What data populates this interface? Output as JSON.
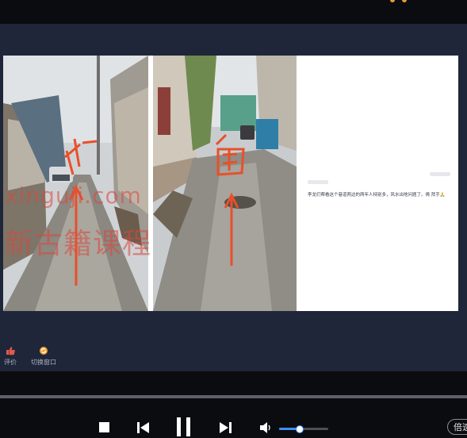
{
  "watermark": {
    "line1": "xinguji.com",
    "line2": "新古籍课程"
  },
  "annotations": {
    "left_char": "北",
    "right_char": "南"
  },
  "comment": {
    "text": "李龙们帮看这个巷道两边的两年人特别多，风水出啥问题了。祷 拜手🙏"
  },
  "toolbar": {
    "rate_label": "评价",
    "switch_window_label": "切换窗口"
  },
  "player": {
    "speed_label": "倍速",
    "volume_level": 0.42
  },
  "colors": {
    "accent": "#3f8ef5",
    "annotation_red": "#e8502a",
    "background": "#1f2639"
  }
}
